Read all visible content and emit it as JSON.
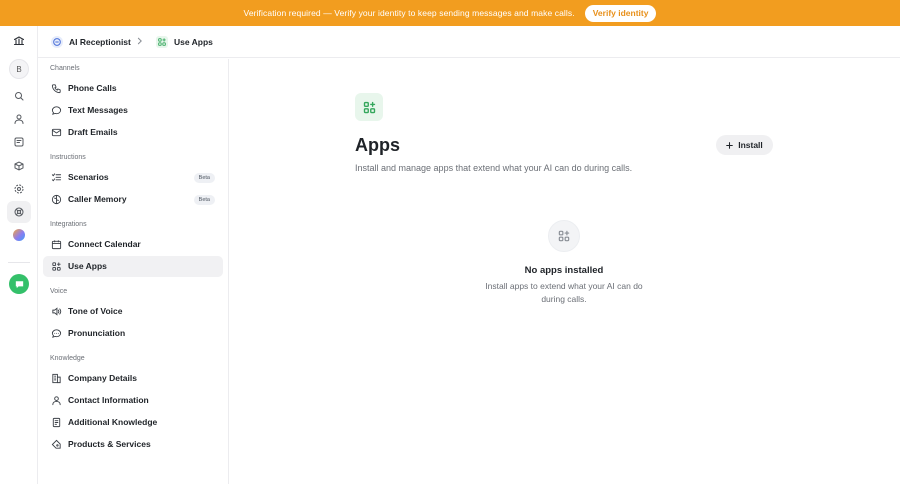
{
  "banner": {
    "text": "Verification required — Verify your identity to keep sending messages and make calls.",
    "button_label": "Verify identity"
  },
  "rail": {
    "workspace_initial": "B"
  },
  "header": {
    "crumb1": "AI Receptionist",
    "crumb2": "Use Apps"
  },
  "sidebar": {
    "sections": {
      "channels": "Channels",
      "instructions": "Instructions",
      "integrations": "Integrations",
      "voice": "Voice",
      "knowledge": "Knowledge"
    },
    "items": {
      "phone_calls": "Phone Calls",
      "text_messages": "Text Messages",
      "draft_emails": "Draft Emails",
      "scenarios": "Scenarios",
      "caller_memory": "Caller Memory",
      "connect_calendar": "Connect Calendar",
      "use_apps": "Use Apps",
      "tone_of_voice": "Tone of Voice",
      "pronunciation": "Pronunciation",
      "company_details": "Company Details",
      "contact_information": "Contact Information",
      "additional_knowledge": "Additional Knowledge",
      "products_services": "Products & Services"
    },
    "beta_label": "Beta"
  },
  "main": {
    "title": "Apps",
    "subtitle": "Install and manage apps that extend what your AI can do during calls.",
    "install_label": "Install",
    "empty_title": "No apps installed",
    "empty_subtitle": "Install apps to extend what your AI can do during calls."
  },
  "colors": {
    "banner": "#f29d1f",
    "accent_green": "#34c06a"
  }
}
